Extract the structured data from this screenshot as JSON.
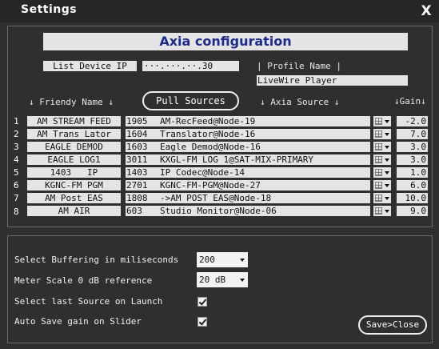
{
  "window": {
    "title": "Settings",
    "close_label": "X"
  },
  "header": {
    "title": "Axia configuration"
  },
  "device": {
    "list_ip_label": "List Device IP",
    "ip_value": "···.···.··.30",
    "profile_label": "| Profile Name |",
    "profile_value": "LiveWire Player"
  },
  "columns": {
    "friendly_name": "↓ Friendy Name ↓",
    "pull_sources": "Pull Sources",
    "axia_source": "↓ Axia Source ↓",
    "gain": "↓Gain↓"
  },
  "rows": [
    {
      "n": "1",
      "name": "AM STREAM FEED",
      "num": "1905",
      "src": "AM-RecFeed@Node-19",
      "gain": "-2.0"
    },
    {
      "n": "2",
      "name": "AM Trans Lator",
      "num": "1604",
      "src": "Translator@Node-16",
      "gain": "7.0"
    },
    {
      "n": "3",
      "name": "EAGLE DEMOD",
      "num": "1603",
      "src": "Eagle Demod@Node-16",
      "gain": "3.0"
    },
    {
      "n": "4",
      "name": "EAGLE LOG1",
      "num": "3011",
      "src": "KXGL-FM LOG 1@SAT-MIX-PRIMARY",
      "gain": "3.0"
    },
    {
      "n": "5",
      "name": "1403   IP",
      "num": "1403",
      "src": "IP Codec@Node-14",
      "gain": "1.0"
    },
    {
      "n": "6",
      "name": "KGNC-FM PGM",
      "num": "2701",
      "src": "KGNC-FM-PGM@Node-27",
      "gain": "6.0"
    },
    {
      "n": "7",
      "name": "AM Post EAS",
      "num": "1808",
      "src": "->AM POST EAS@Node-18",
      "gain": "10.0"
    },
    {
      "n": "8",
      "name": "AM AIR",
      "num": "603",
      "src": "Studio Monitor@Node-06",
      "gain": "9.0"
    }
  ],
  "options": {
    "buffering_label": "Select Buffering in miliseconds",
    "buffering_value": "200",
    "meter_label": "Meter Scale 0 dB reference",
    "meter_value": "20 dB",
    "last_source_label": "Select last Source on Launch",
    "last_source_checked": true,
    "auto_save_label": "Auto Save gain on Slider",
    "auto_save_checked": true
  },
  "save_label": "Save>Close",
  "icons": {
    "close": "close-icon",
    "dropdown": "dropdown-arrow-icon",
    "grid": "grid-icon",
    "check": "checkmark-icon"
  }
}
